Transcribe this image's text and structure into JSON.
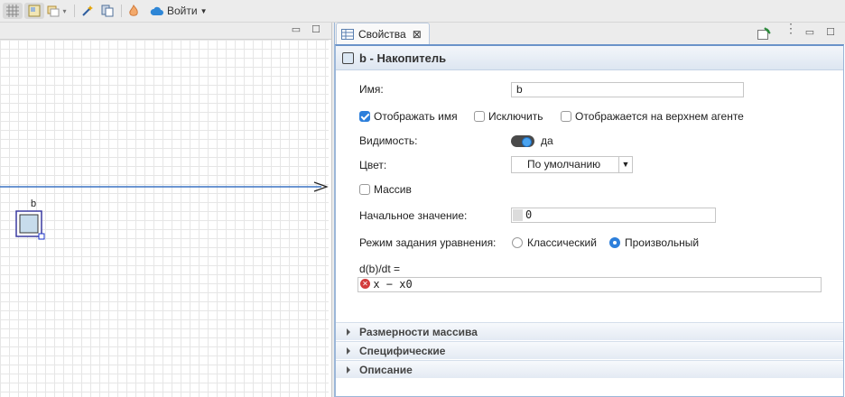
{
  "toolbar": {
    "login_label": "Войти",
    "icons": [
      "grid-icon",
      "fit-icon",
      "layers-icon",
      "wand-icon",
      "pages-icon",
      "flame-icon",
      "cloud-icon"
    ]
  },
  "canvas": {
    "element_label": "b"
  },
  "properties": {
    "tab_label": "Свойства",
    "header_title": "b - Накопитель",
    "name_label": "Имя:",
    "name_value": "b",
    "show_name_label": "Отображать имя",
    "show_name_checked": true,
    "exclude_label": "Исключить",
    "exclude_checked": false,
    "top_agent_label": "Отображается на верхнем агенте",
    "top_agent_checked": false,
    "visibility_label": "Видимость:",
    "visibility_value": "да",
    "color_label": "Цвет:",
    "color_value": "По умолчанию",
    "array_label": "Массив",
    "array_checked": false,
    "initial_label": "Начальное значение:",
    "initial_value": "0",
    "mode_label": "Режим задания уравнения:",
    "mode_classic": "Классический",
    "mode_custom": "Произвольный",
    "mode_selected": "Произвольный",
    "equation_label": "d(b)/dt =",
    "equation_value": "x − x0",
    "sections": [
      "Размерности массива",
      "Специфические",
      "Описание"
    ]
  },
  "colors": {
    "accent": "#2d7fdb",
    "panel_border": "#9bb6d8",
    "flow_line": "#3b73c4",
    "error": "#d23b3b"
  }
}
